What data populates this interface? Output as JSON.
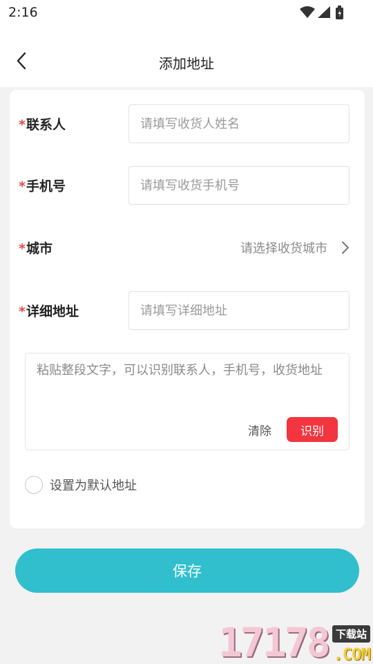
{
  "status_bar": {
    "time": "2:16"
  },
  "nav": {
    "title": "添加地址"
  },
  "form": {
    "required_mark": "*",
    "contact": {
      "label": "联系人",
      "placeholder": "请填写收货人姓名"
    },
    "phone": {
      "label": "手机号",
      "placeholder": "请填写收货手机号"
    },
    "city": {
      "label": "城市",
      "placeholder": "请选择收货城市"
    },
    "address": {
      "label": "详细地址",
      "placeholder": "请填写详细地址"
    },
    "paste": {
      "placeholder": "粘贴整段文字，可以识别联系人，手机号，收货地址",
      "clear_label": "清除",
      "recognize_label": "识别"
    },
    "default_label": "设置为默认地址"
  },
  "save_label": "保存",
  "watermark": {
    "number": "17178",
    "tag": "下载站",
    "domain": ".COM"
  },
  "colors": {
    "accent": "#31bfce",
    "required": "#e24b4b",
    "recognize": "#f2353e",
    "background": "#f2f2f2"
  },
  "icons": {
    "back": "chevron-left-icon",
    "city_arrow": "chevron-right-icon",
    "wifi": "wifi-icon",
    "signal": "signal-icon",
    "battery": "battery-icon"
  }
}
